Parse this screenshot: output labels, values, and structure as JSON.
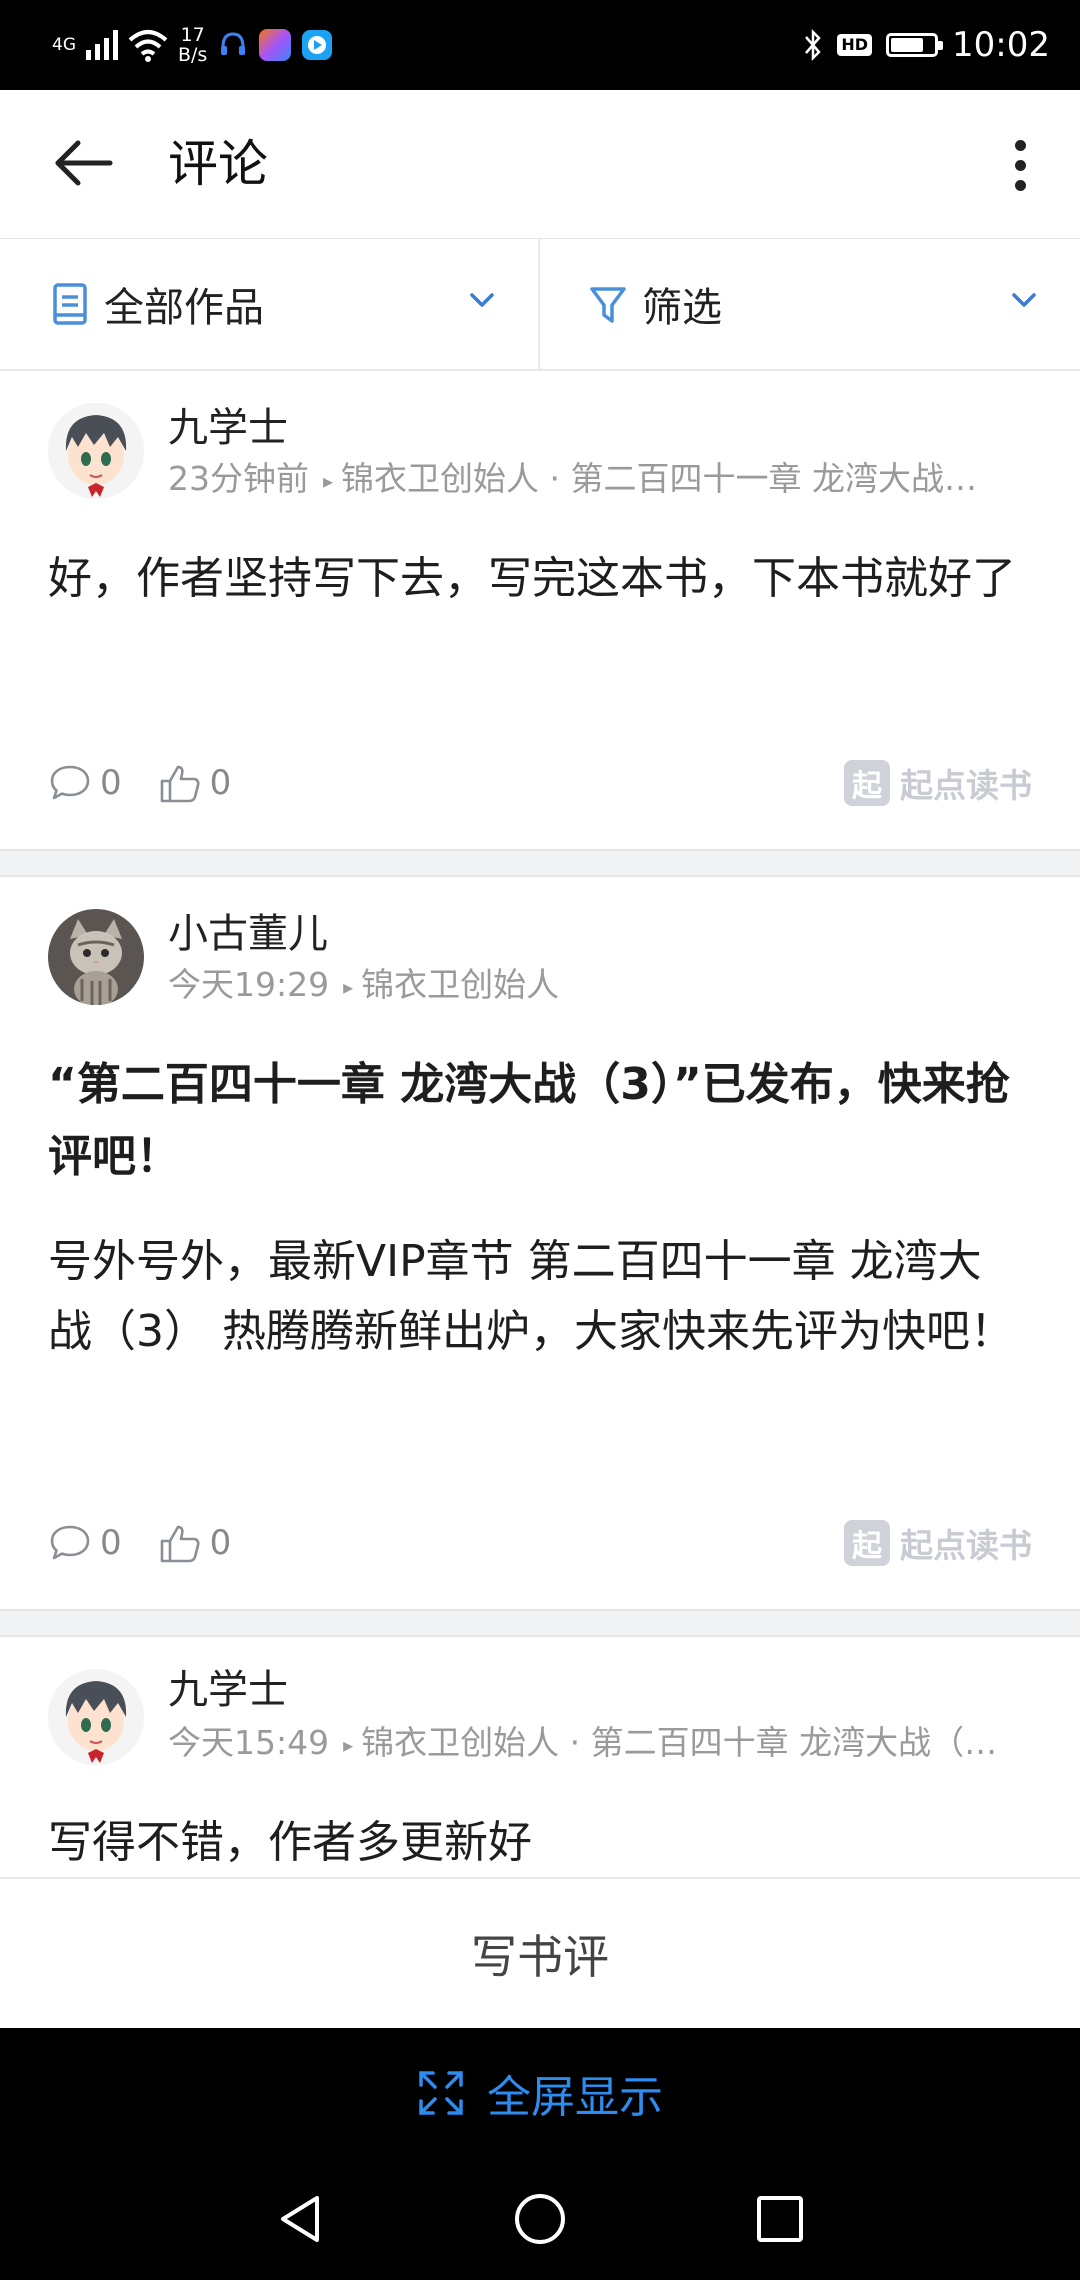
{
  "status_bar": {
    "network": "4G",
    "speed_value": "17",
    "speed_unit": "B/s",
    "hd": "HD",
    "battery_level": 0.75,
    "time": "10:02"
  },
  "header": {
    "title": "评论"
  },
  "filters": {
    "works_label": "全部作品",
    "filter_label": "筛选"
  },
  "feed": [
    {
      "user": "九学士",
      "time": "23分钟前",
      "location": "锦衣卫创始人 · 第二百四十一章 龙湾大战…",
      "title": "",
      "body": "好，作者坚持写下去，写完这本书，下本书就好了",
      "comments": "0",
      "likes": "0",
      "source": "起点读书",
      "avatar_icon": "anime-boy-avatar"
    },
    {
      "user": "小古董儿",
      "time": "今天19:29",
      "location": "锦衣卫创始人",
      "title": "“第二百四十一章 龙湾大战（3）”已发布，快来抢评吧！",
      "body": "号外号外，最新VIP章节 第二百四十一章 龙湾大战（3） 热腾腾新鲜出炉，大家快来先评为快吧！",
      "comments": "0",
      "likes": "0",
      "source": "起点读书",
      "avatar_icon": "kitten-avatar"
    },
    {
      "user": "九学士",
      "time": "今天15:49",
      "location": "锦衣卫创始人 · 第二百四十章 龙湾大战（…",
      "body": "写得不错，作者多更新好",
      "avatar_icon": "anime-boy-avatar"
    }
  ],
  "write_review": "写书评",
  "fullscreen": "全屏显示",
  "colors": {
    "accent": "#2d8cf0",
    "muted": "#9a9a9a",
    "divider": "#f2f3f5"
  }
}
